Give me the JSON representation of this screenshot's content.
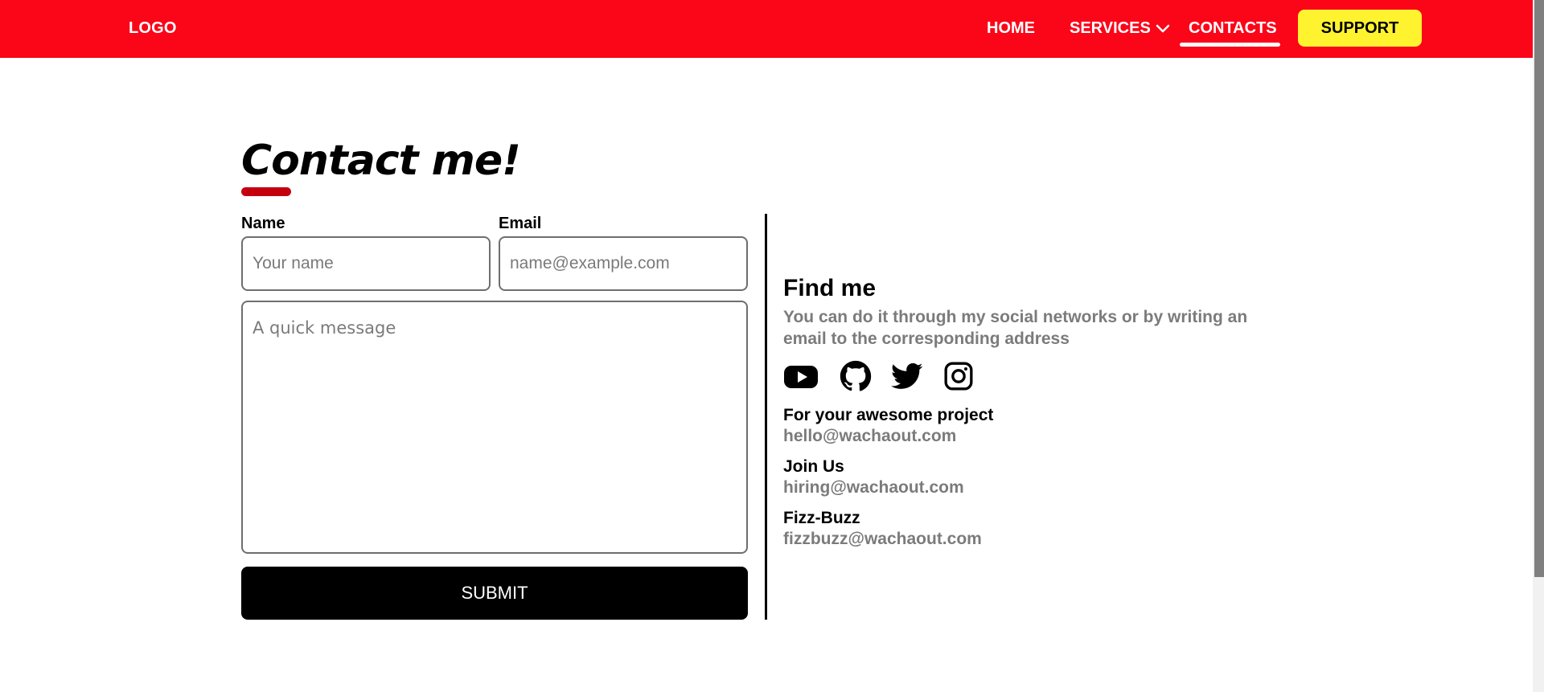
{
  "nav": {
    "logo": "LOGO",
    "home": "HOME",
    "services": "SERVICES",
    "contacts": "CONTACTS",
    "support": "SUPPORT"
  },
  "colors": {
    "nav_bg": "#fb0519",
    "support_bg": "#fff32f",
    "accent": "#c4000f",
    "muted_text": "#7b7b7b"
  },
  "page": {
    "title": "Contact me!"
  },
  "form": {
    "name_label": "Name",
    "email_label": "Email",
    "name_placeholder": "Your name",
    "email_placeholder": "name@example.com",
    "message_placeholder": "A quick message",
    "submit_label": "SUBMIT"
  },
  "find_me": {
    "title": "Find me",
    "description": "You can do it through my social networks or by writing an email to the corresponding address",
    "socials": [
      "youtube-icon",
      "github-icon",
      "twitter-icon",
      "instagram-icon"
    ],
    "contacts": [
      {
        "label": "For your awesome project",
        "email": "hello@wachaout.com"
      },
      {
        "label": "Join Us",
        "email": "hiring@wachaout.com"
      },
      {
        "label": "Fizz-Buzz",
        "email": "fizzbuzz@wachaout.com"
      }
    ]
  }
}
